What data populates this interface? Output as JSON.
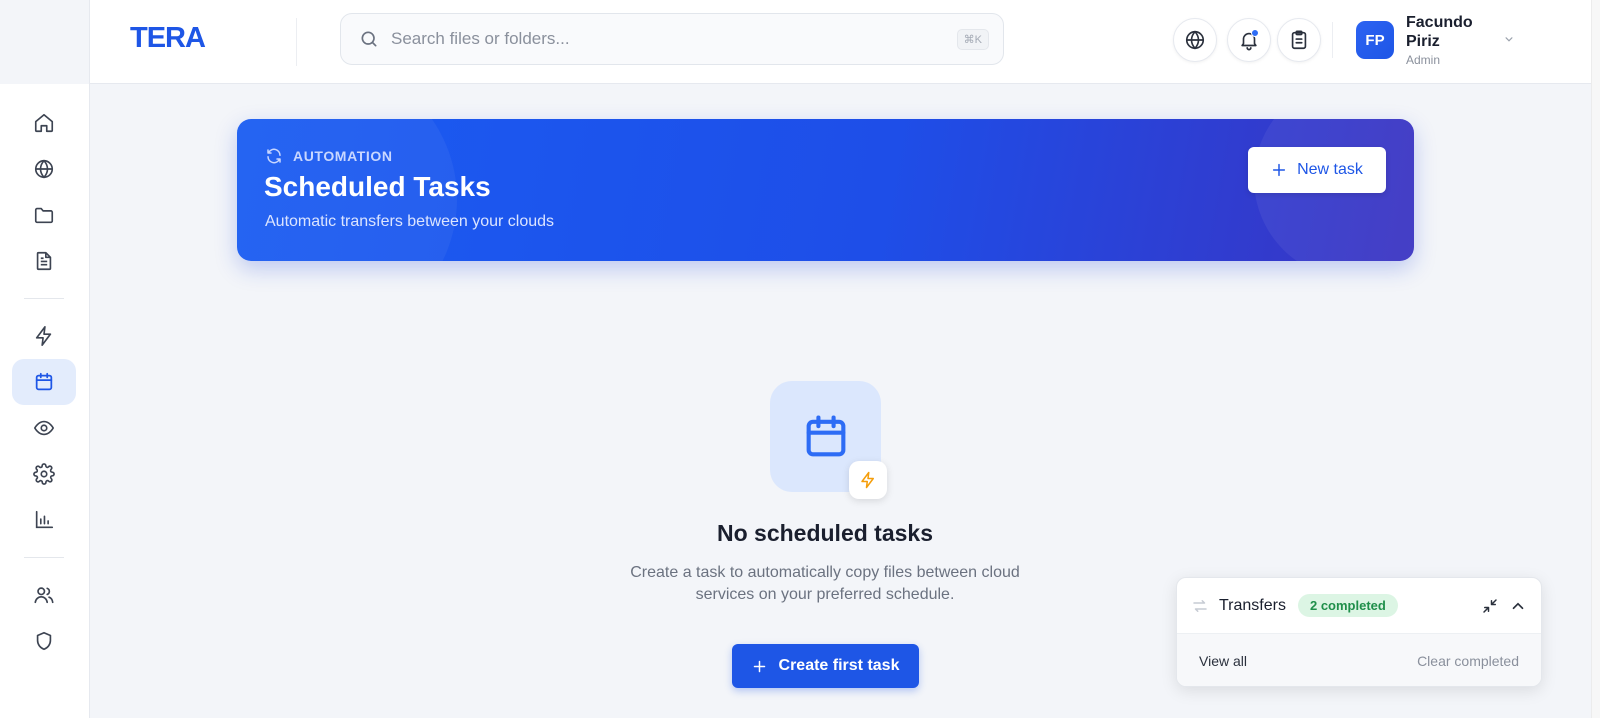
{
  "app": {
    "logo": "TERA"
  },
  "search": {
    "placeholder": "Search files or folders...",
    "shortcut": "⌘K"
  },
  "user": {
    "initials": "FP",
    "name": "Facundo Piriz",
    "role": "Admin"
  },
  "hero": {
    "eyebrow": "AUTOMATION",
    "title": "Scheduled Tasks",
    "subtitle": "Automatic transfers between your clouds",
    "new_task_label": "New task"
  },
  "empty": {
    "title": "No scheduled tasks",
    "desc_line1": "Create a task to automatically copy files between cloud",
    "desc_line2": "services on your preferred schedule.",
    "create_label": "Create first task"
  },
  "transfers": {
    "title": "Transfers",
    "badge": "2 completed",
    "view_all": "View all",
    "clear": "Clear completed"
  },
  "sidebar": {
    "items": [
      {
        "icon": "home-icon"
      },
      {
        "icon": "globe-icon"
      },
      {
        "icon": "folder-icon"
      },
      {
        "icon": "document-icon"
      },
      {
        "icon": "bolt-icon"
      },
      {
        "icon": "calendar-icon",
        "active": true
      },
      {
        "icon": "eye-icon"
      },
      {
        "icon": "gear-icon"
      },
      {
        "icon": "bar-chart-icon"
      },
      {
        "icon": "users-icon"
      },
      {
        "icon": "shield-icon"
      }
    ]
  },
  "colors": {
    "accent": "#1e56e6",
    "success_bg": "#dcf5e4",
    "success_text": "#1f8f4a",
    "warning": "#f59e0b"
  }
}
